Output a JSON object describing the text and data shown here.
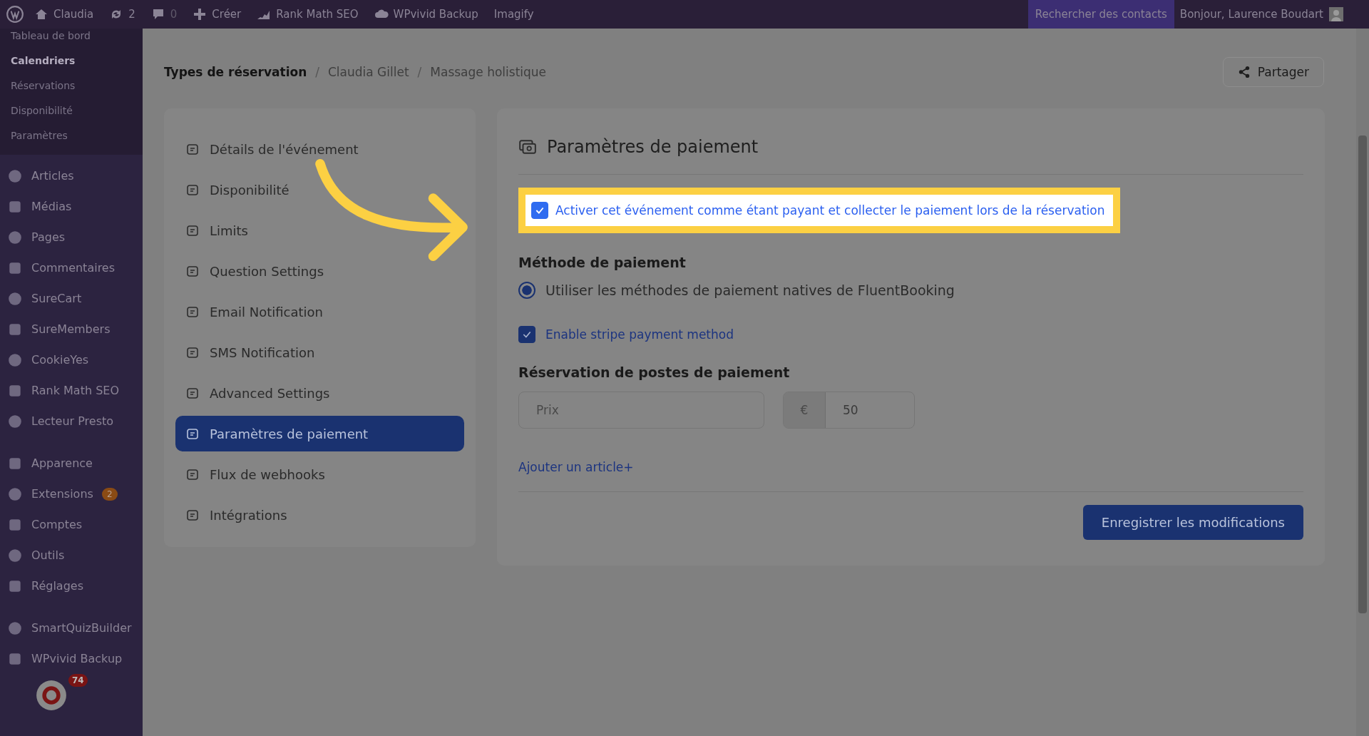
{
  "admin_bar": {
    "items": [
      {
        "label": "Claudia"
      },
      {
        "label": "2"
      },
      {
        "label": "0"
      },
      {
        "label": "Créer"
      },
      {
        "label": "Rank Math SEO"
      },
      {
        "label": "WPvivid Backup"
      },
      {
        "label": "Imagify"
      }
    ],
    "search": "Rechercher des contacts",
    "greeting": "Bonjour, Laurence Boudart"
  },
  "sidebar": {
    "submenu": [
      {
        "label": "Tableau de bord",
        "selected": false
      },
      {
        "label": "Calendriers",
        "selected": true
      },
      {
        "label": "Réservations",
        "selected": false
      },
      {
        "label": "Disponibilité",
        "selected": false
      },
      {
        "label": "Paramètres",
        "selected": false
      }
    ],
    "groups": [
      [
        {
          "label": "Articles"
        },
        {
          "label": "Médias"
        },
        {
          "label": "Pages"
        },
        {
          "label": "Commentaires"
        },
        {
          "label": "SureCart"
        },
        {
          "label": "SureMembers"
        },
        {
          "label": "CookieYes"
        },
        {
          "label": "Rank Math SEO"
        },
        {
          "label": "Lecteur Presto"
        }
      ],
      [
        {
          "label": "Apparence"
        },
        {
          "label": "Extensions",
          "badge": "2"
        },
        {
          "label": "Comptes"
        },
        {
          "label": "Outils"
        },
        {
          "label": "Réglages"
        }
      ],
      [
        {
          "label": "SmartQuizBuilder"
        },
        {
          "label": "WPvivid Backup"
        }
      ]
    ],
    "chat_badge": "74"
  },
  "breadcrumb": [
    {
      "label": "Types de réservation"
    },
    {
      "label": "Claudia Gillet"
    },
    {
      "label": "Massage holistique"
    }
  ],
  "breadcrumb_separator": "/",
  "share_button": "Partager",
  "nav": [
    {
      "label": "Détails de l'événement",
      "selected": false
    },
    {
      "label": "Disponibilité",
      "selected": false
    },
    {
      "label": "Limits",
      "selected": false
    },
    {
      "label": "Question Settings",
      "selected": false
    },
    {
      "label": "Email Notification",
      "selected": false
    },
    {
      "label": "SMS Notification",
      "selected": false
    },
    {
      "label": "Advanced Settings",
      "selected": false
    },
    {
      "label": "Paramètres de paiement",
      "selected": true
    },
    {
      "label": "Flux de webhooks",
      "selected": false
    },
    {
      "label": "Intégrations",
      "selected": false
    }
  ],
  "panel": {
    "title": "Paramètres de paiement",
    "paid_checkbox": {
      "label": "Activer cet événement comme étant payant et collecter le paiement lors de la réservation",
      "checked": true,
      "highlighted": true
    },
    "method_heading": "Méthode de paiement",
    "method_radio": {
      "label": "Utiliser les méthodes de paiement natives de FluentBooking",
      "selected": true
    },
    "stripe_checkbox": {
      "label": "Enable stripe payment method",
      "checked": true
    },
    "items_heading": "Réservation de postes de paiement",
    "price_field": {
      "placeholder": "Prix"
    },
    "amount_field": {
      "currency": "€",
      "value": "50"
    },
    "add_link": "Ajouter un article+",
    "save_button": "Enregistrer les modifications"
  }
}
